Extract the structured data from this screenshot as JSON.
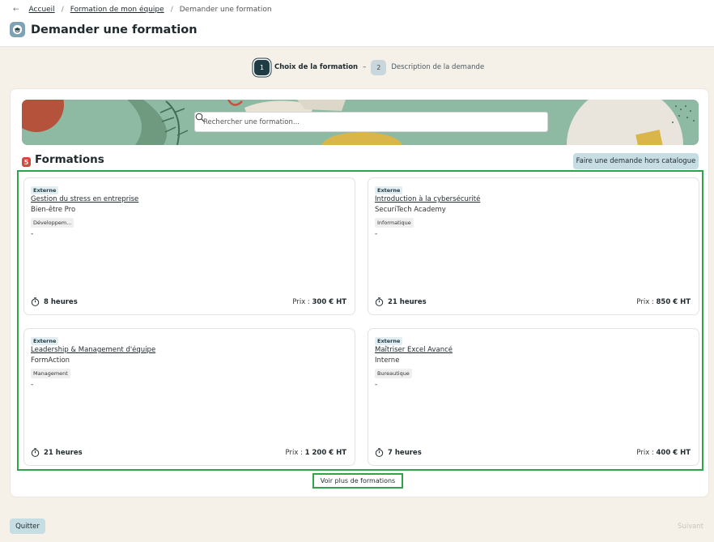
{
  "breadcrumb": {
    "back": "←",
    "items": [
      "Accueil",
      "Formation de mon équipe"
    ],
    "current": "Demander une formation",
    "separator": "/"
  },
  "page": {
    "title": "Demander une formation"
  },
  "stepper": {
    "steps": [
      {
        "number": "1",
        "label": "Choix de la formation",
        "active": true
      },
      {
        "number": "2",
        "label": "Description de la demande",
        "active": false
      }
    ],
    "dash": "–"
  },
  "search": {
    "placeholder": "Rechercher une formation..."
  },
  "formations": {
    "count": "5",
    "title": "Formations",
    "hors_catalogue_label": "Faire une demande hors catalogue",
    "items": [
      {
        "type": "Externe",
        "title": "Gestion du stress en entreprise",
        "provider": "Bien-être Pro",
        "category": "Développem...",
        "description": "-",
        "duration": "8 heures",
        "price_prefix": "Prix : ",
        "price": "300 € HT"
      },
      {
        "type": "Externe",
        "title": "Introduction à la cybersécurité",
        "provider": "SecuriTech Academy",
        "category": "Informatique",
        "description": "-",
        "duration": "21 heures",
        "price_prefix": "Prix : ",
        "price": "850 € HT"
      },
      {
        "type": "Externe",
        "title": "Leadership & Management d'équipe",
        "provider": "FormAction",
        "category": "Management",
        "description": "-",
        "duration": "21 heures",
        "price_prefix": "Prix : ",
        "price": "1 200 € HT"
      },
      {
        "type": "Externe",
        "title": "Maîtriser Excel Avancé",
        "provider": "Interne",
        "category": "Bureautique",
        "description": "-",
        "duration": "7 heures",
        "price_prefix": "Prix : ",
        "price": "400 € HT"
      }
    ],
    "voir_plus_label": "Voir plus de formations"
  },
  "footer": {
    "quit_label": "Quitter",
    "next_label": "Suivant"
  },
  "colors": {
    "accent": "#1f3b44",
    "highlight": "#2ea54b",
    "badge": "#d2493e",
    "secondary_button": "#c7dde4"
  }
}
